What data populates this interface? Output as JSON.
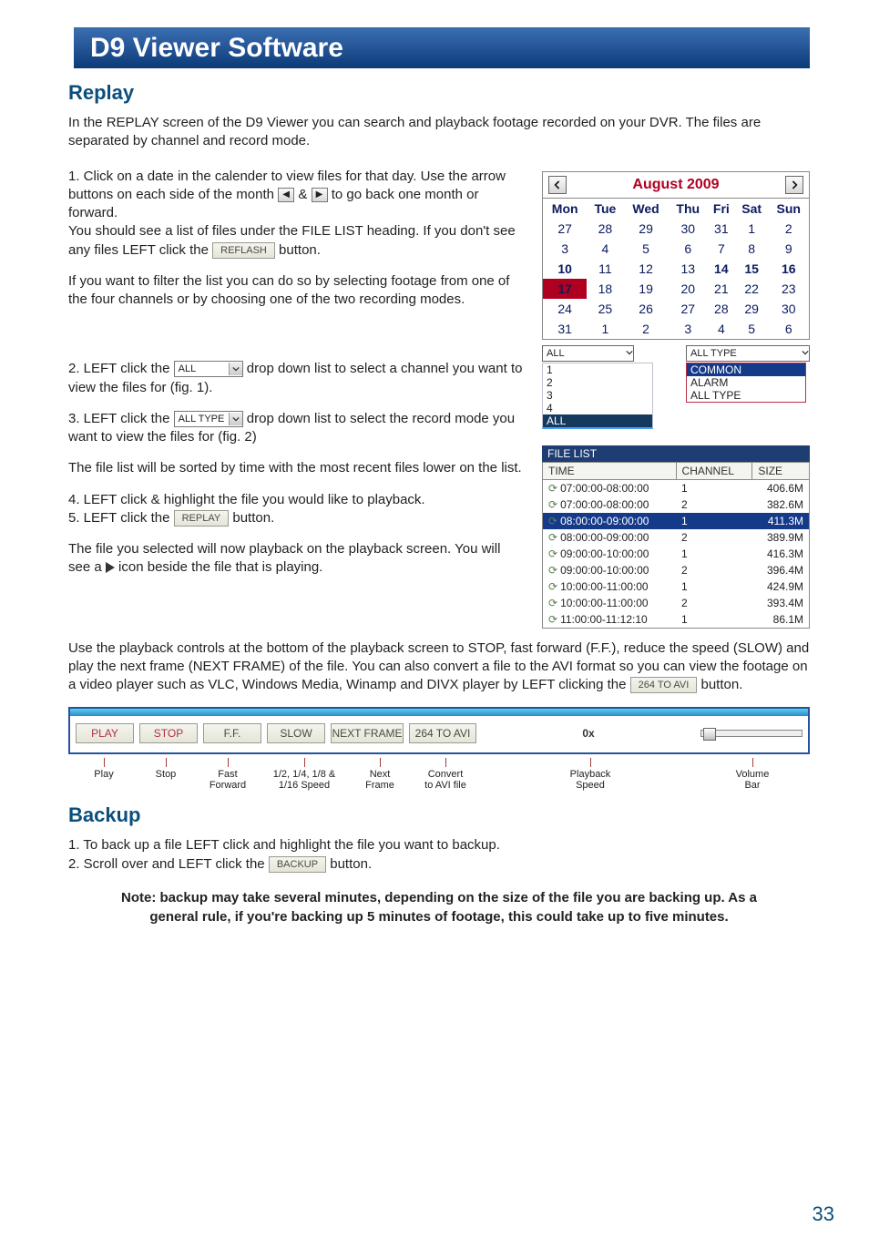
{
  "title": "D9 Viewer Software",
  "page_number": "33",
  "replay": {
    "heading": "Replay",
    "intro": "In the REPLAY screen of the D9 Viewer you can search and playback footage recorded on your DVR. The files are separated by channel and record mode.",
    "p1a": "1. Click on a date in the calender to view files for that day. Use the arrow buttons on each side of the month ",
    "p1b": " & ",
    "p1c": " to go back one month or forward.",
    "p2a": "You should see a list of files under the FILE LIST heading. If you don't see any files LEFT click the ",
    "p2b": " button.",
    "p3": "If you want to filter the list you can do so by selecting footage from one of the four channels or by choosing one of the two recording modes.",
    "p4a": "2. LEFT click the ",
    "p4b": " drop down list to select a channel you want to view the files for (fig. 1).",
    "p5a": "3. LEFT click the ",
    "p5b": " drop down list to select the record mode you want to view the files for (fig. 2)",
    "p6": "The file list will be sorted by time with the most recent files lower on the list.",
    "p7": "4. LEFT click & highlight the file you would like to playback.",
    "p8a": "5. LEFT click the ",
    "p8b": " button.",
    "p9a": "The file you selected will now playback on the playback screen. You will see a ",
    "p9b": " icon beside the file that is playing.",
    "p10a": "Use the playback controls at the bottom of the playback screen to STOP, fast forward (F.F.), reduce the speed (SLOW) and play the next frame (NEXT FRAME) of the file. You can also convert a file to the AVI format so you can view the footage on a video player such as VLC, Windows Media, Winamp and DIVX player by LEFT clicking the ",
    "p10b": " button.",
    "reflash_label": "REFLASH",
    "replay_label": "REPLAY",
    "avi_label": "264 TO AVI",
    "all_label": "ALL",
    "alltype_label": "ALL TYPE"
  },
  "calendar": {
    "title": "August 2009",
    "dow": [
      "Mon",
      "Tue",
      "Wed",
      "Thu",
      "Fri",
      "Sat",
      "Sun"
    ],
    "rows": [
      [
        {
          "d": "27",
          "o": true
        },
        {
          "d": "28",
          "o": true
        },
        {
          "d": "29",
          "o": true
        },
        {
          "d": "30",
          "o": true
        },
        {
          "d": "31",
          "o": true
        },
        {
          "d": "1"
        },
        {
          "d": "2"
        }
      ],
      [
        {
          "d": "3"
        },
        {
          "d": "4"
        },
        {
          "d": "5"
        },
        {
          "d": "6"
        },
        {
          "d": "7"
        },
        {
          "d": "8"
        },
        {
          "d": "9"
        }
      ],
      [
        {
          "d": "10",
          "b": true
        },
        {
          "d": "11"
        },
        {
          "d": "12"
        },
        {
          "d": "13"
        },
        {
          "d": "14",
          "b": true
        },
        {
          "d": "15",
          "b": true
        },
        {
          "d": "16",
          "b": true
        }
      ],
      [
        {
          "d": "17",
          "sel": true
        },
        {
          "d": "18"
        },
        {
          "d": "19"
        },
        {
          "d": "20"
        },
        {
          "d": "21"
        },
        {
          "d": "22"
        },
        {
          "d": "23"
        }
      ],
      [
        {
          "d": "24"
        },
        {
          "d": "25"
        },
        {
          "d": "26"
        },
        {
          "d": "27"
        },
        {
          "d": "28"
        },
        {
          "d": "29"
        },
        {
          "d": "30"
        }
      ],
      [
        {
          "d": "31"
        },
        {
          "d": "1",
          "o": true
        },
        {
          "d": "2",
          "o": true
        },
        {
          "d": "3",
          "o": true
        },
        {
          "d": "4",
          "o": true
        },
        {
          "d": "5",
          "o": true
        },
        {
          "d": "6",
          "o": true
        }
      ]
    ]
  },
  "selectors": {
    "channel_dd": "ALL",
    "type_dd": "ALL TYPE",
    "chan_items": [
      "1",
      "2",
      "3",
      "4",
      "ALL"
    ],
    "type_items": [
      "COMMON",
      "ALARM",
      "ALL TYPE"
    ]
  },
  "filelist": {
    "title": "FILE LIST",
    "headers": [
      "TIME",
      "CHANNEL",
      "SIZE"
    ],
    "rows": [
      {
        "t": "07:00:00-08:00:00",
        "c": "1",
        "s": "406.6M"
      },
      {
        "t": "07:00:00-08:00:00",
        "c": "2",
        "s": "382.6M"
      },
      {
        "t": "08:00:00-09:00:00",
        "c": "1",
        "s": "411.3M",
        "sel": true
      },
      {
        "t": "08:00:00-09:00:00",
        "c": "2",
        "s": "389.9M"
      },
      {
        "t": "09:00:00-10:00:00",
        "c": "1",
        "s": "416.3M"
      },
      {
        "t": "09:00:00-10:00:00",
        "c": "2",
        "s": "396.4M"
      },
      {
        "t": "10:00:00-11:00:00",
        "c": "1",
        "s": "424.9M"
      },
      {
        "t": "10:00:00-11:00:00",
        "c": "2",
        "s": "393.4M"
      },
      {
        "t": "11:00:00-11:12:10",
        "c": "1",
        "s": "86.1M"
      }
    ]
  },
  "playbar": {
    "play": "PLAY",
    "stop": "STOP",
    "ff": "F.F.",
    "slow": "SLOW",
    "next": "NEXT FRAME",
    "avi": "264 TO AVI",
    "speed": "0x",
    "cap_play": "Play",
    "cap_stop": "Stop",
    "cap_ff": "Fast\nForward",
    "cap_slow": "1/2, 1/4, 1/8 &\n1/16 Speed",
    "cap_next": "Next\nFrame",
    "cap_avi": "Convert\nto AVI file",
    "cap_speed": "Playback\nSpeed",
    "cap_vol": "Volume\nBar"
  },
  "backup": {
    "heading": "Backup",
    "p1": "1. To back up a file LEFT click and highlight the file you want to backup.",
    "p2a": "2. Scroll over and LEFT click the ",
    "p2b": " button.",
    "backup_label": "BACKUP",
    "note": "Note: backup may take several minutes, depending on the size of the file you are backing up. As a general rule, if you're backing up 5 minutes of footage, this could take up to five minutes."
  }
}
